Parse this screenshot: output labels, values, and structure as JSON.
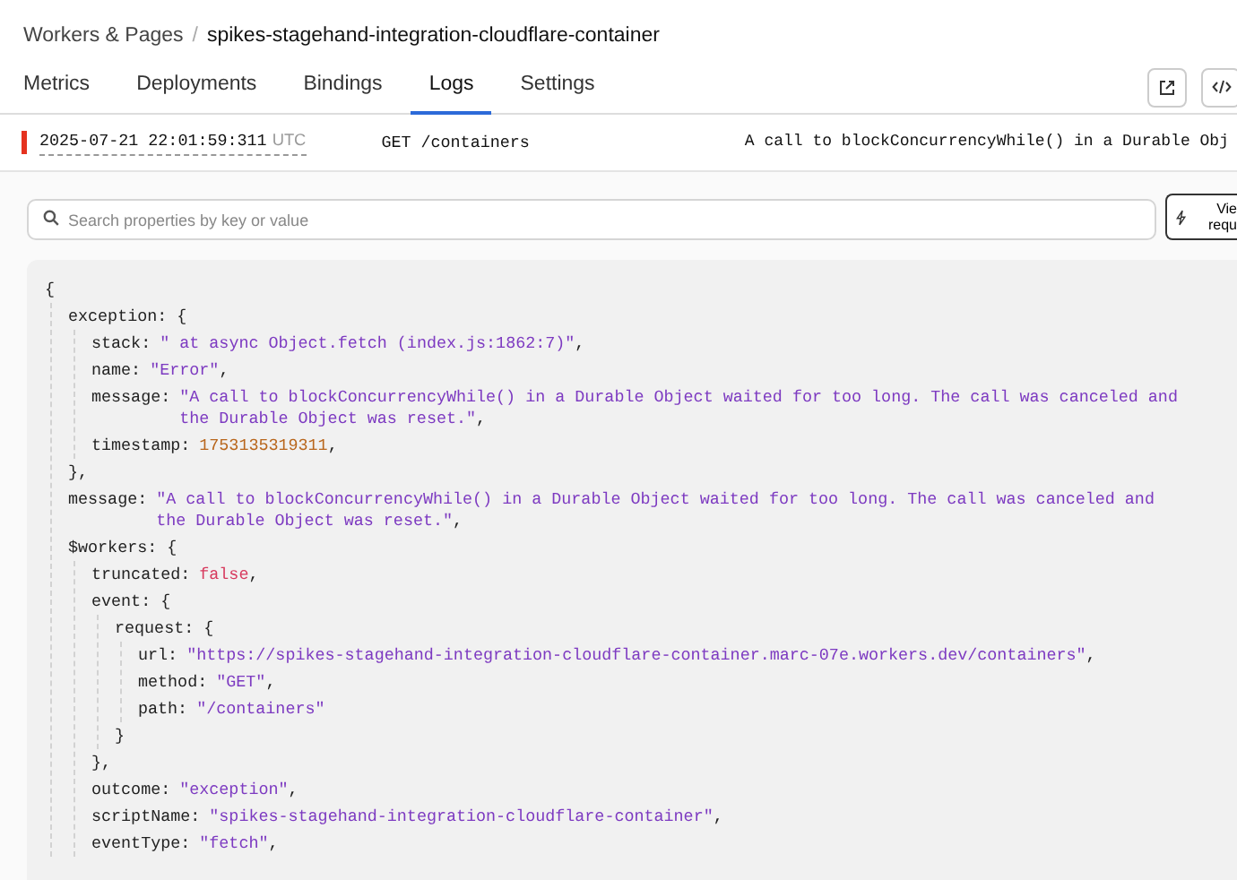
{
  "breadcrumb": {
    "parent": "Workers & Pages",
    "separator": "/",
    "current": "spikes-stagehand-integration-cloudflare-container"
  },
  "tabs": [
    {
      "label": "Metrics",
      "selected": false
    },
    {
      "label": "Deployments",
      "selected": false
    },
    {
      "label": "Bindings",
      "selected": false
    },
    {
      "label": "Logs",
      "selected": true
    },
    {
      "label": "Settings",
      "selected": false
    }
  ],
  "log_row": {
    "color": "#e5321f",
    "timestamp": "2025-07-21 22:01:59:311",
    "timezone": "UTC",
    "request": "GET /containers",
    "message": "A call to blockConcurrencyWhile() in a Durable Obj"
  },
  "search": {
    "placeholder": "Search properties by key or value"
  },
  "view_button": {
    "label": "Vie requ"
  },
  "code": {
    "head": "{",
    "children": [
      {
        "head": "exception: {",
        "tail": "},",
        "children": [
          {
            "key": "stack:",
            "value": "\" at async Object.fetch (index.js:1862:7)\"",
            "kind": "string",
            "tail": ","
          },
          {
            "key": "name:",
            "value": "\"Error\"",
            "kind": "string",
            "tail": ","
          },
          {
            "key": "message:",
            "value": "\"A call to blockConcurrencyWhile() in a Durable Object waited for too long. The call was canceled and the Durable Object was reset.\"",
            "kind": "string",
            "tail": ","
          },
          {
            "key": "timestamp:",
            "value": "1753135319311",
            "kind": "number",
            "tail": ","
          }
        ]
      },
      {
        "key": "message:",
        "value": "\"A call to blockConcurrencyWhile() in a Durable Object waited for too long. The call was canceled and the Durable Object was reset.\"",
        "kind": "string",
        "tail": ","
      },
      {
        "head": "$workers: {",
        "children": [
          {
            "key": "truncated:",
            "value": "false",
            "kind": "boolean",
            "tail": ","
          },
          {
            "head": "event: {",
            "tail": "},",
            "children": [
              {
                "head": "request: {",
                "tail": "}",
                "children": [
                  {
                    "key": "url:",
                    "value": "\"https://spikes-stagehand-integration-cloudflare-container.marc-07e.workers.dev/containers\"",
                    "kind": "string",
                    "tail": ","
                  },
                  {
                    "key": "method:",
                    "value": "\"GET\"",
                    "kind": "string",
                    "tail": ","
                  },
                  {
                    "key": "path:",
                    "value": "\"/containers\"",
                    "kind": "string"
                  }
                ]
              }
            ]
          },
          {
            "key": "outcome:",
            "value": "\"exception\"",
            "kind": "string",
            "tail": ","
          },
          {
            "key": "scriptName:",
            "value": "\"spikes-stagehand-integration-cloudflare-container\"",
            "kind": "string",
            "tail": ","
          },
          {
            "key": "eventType:",
            "value": "\"fetch\"",
            "kind": "string",
            "tail": ","
          }
        ]
      }
    ]
  }
}
